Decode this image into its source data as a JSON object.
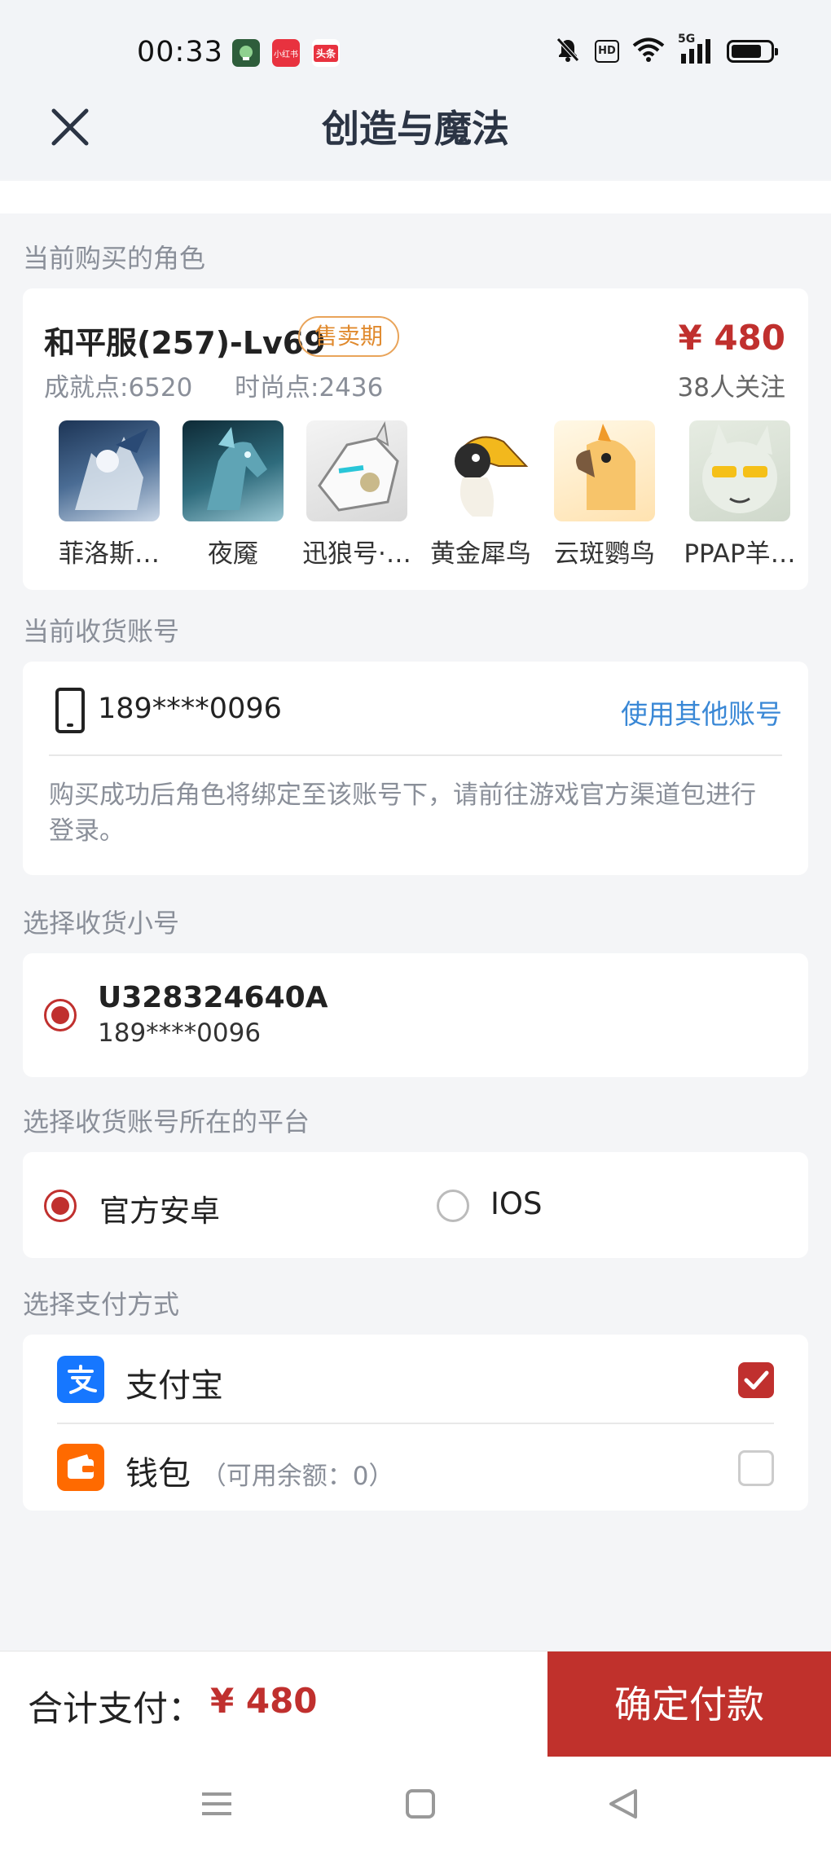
{
  "status_bar": {
    "time": "00:33",
    "apps": [
      {
        "name": "security-app-icon",
        "color": "#2e5d3b",
        "text": ""
      },
      {
        "name": "xiaohongshu-icon",
        "color": "#e8323f",
        "text": "小红书"
      },
      {
        "name": "toutiao-icon",
        "color": "#e8323f",
        "text": "头条"
      }
    ],
    "network": "5G",
    "hd_label": "HD"
  },
  "header": {
    "title": "创造与魔法"
  },
  "sections": {
    "role": "当前购买的角色",
    "account": "当前收货账号",
    "sub_account": "选择收货小号",
    "platform": "选择收货账号所在的平台",
    "payment": "选择支付方式"
  },
  "role": {
    "name": "和平服(257)-Lv69",
    "badge": "售卖期",
    "price": "¥ 480",
    "achievement": "成就点:6520",
    "fashion": "时尚点:2436",
    "followers": "38人关注",
    "pets": [
      {
        "name": "菲洛斯…",
        "icon": "dragon-rider-icon"
      },
      {
        "name": "夜魇",
        "icon": "horse-icon"
      },
      {
        "name": "迅狼号·…",
        "icon": "wolf-icon"
      },
      {
        "name": "黄金犀鸟",
        "icon": "hornbill-icon"
      },
      {
        "name": "云斑鹦鸟",
        "icon": "parrot-icon"
      },
      {
        "name": "PPAP羊…",
        "icon": "sheep-icon"
      }
    ]
  },
  "account": {
    "number": "189****0096",
    "switch_link": "使用其他账号",
    "notice": "购买成功后角色将绑定至该账号下，请前往游戏官方渠道包进行登录。"
  },
  "sub_account": {
    "id": "U328324640A",
    "phone": "189****0096",
    "selected": true
  },
  "platform": {
    "options": [
      {
        "label": "官方安卓",
        "selected": true
      },
      {
        "label": "IOS",
        "selected": false
      }
    ]
  },
  "payment": {
    "options": [
      {
        "label": "支付宝",
        "note": "",
        "checked": true,
        "icon": "alipay-icon",
        "color": "#1677ff"
      },
      {
        "label": "钱包",
        "note": "（可用余额：0）",
        "checked": false,
        "icon": "wallet-icon",
        "color": "#ff6a00"
      }
    ]
  },
  "footer": {
    "total_label": "合计支付：",
    "total_value": "¥ 480",
    "confirm_label": "确定付款"
  },
  "colors": {
    "accent": "#c0302e",
    "link": "#3a88d6",
    "badge": "#e08a2e"
  }
}
